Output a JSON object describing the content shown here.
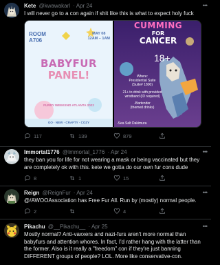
{
  "tweets": [
    {
      "name": "Kete",
      "handle": "@kwawakarl",
      "time": "Apr 24",
      "text": "I will never go to a con again if shit like this is what to expect holy fuck",
      "stats": {
        "reply": "117",
        "retweet": "139",
        "like": "879"
      },
      "media": {
        "left": {
          "room_line1": "ROOM",
          "room_line2": "A706",
          "date_line1": "MAY 08",
          "date_line2": "12AM – 1AM",
          "title_line1": "BABYFUR",
          "title_line2": "PANEL!",
          "footer": "FURRY WEEKEND ATLANTA 2022",
          "bottom": "GO · NEW · CRAFTY · COZY"
        },
        "right": {
          "headline1": "CUMMING",
          "headline2": "FOR",
          "headline3": "CANCER",
          "age": "18+",
          "where1": "Where:",
          "where2": "Presidential Suite",
          "where3": "(Suite# 1800)",
          "drink1": "21+ to drink with provided",
          "drink2": "wristband (ID required)",
          "bartender1": "-Bartender",
          "bartender2": "(themed drinks)",
          "host": "-Sea Salt Dakimura"
        }
      }
    },
    {
      "name": "Immortal1776",
      "handle": "@Immortal_1776",
      "time": "Apr 24",
      "text": "they ban you for life for not wearing a mask or being vaccinated but they are completely ok with this. kete we gotta do our own fur cons dude",
      "stats": {
        "reply": "8",
        "retweet": "1",
        "like": "15"
      }
    },
    {
      "name": "Reign",
      "handle": "@ReignFur",
      "time": "Apr 24",
      "text": "@/AWOOAssociation has Free Fur All. Run by (mostly) normal people.",
      "stats": {
        "reply": "2",
        "retweet": "",
        "like": "4"
      }
    },
    {
      "name": "Pikachu",
      "handle": "@__Pikachu__",
      "time": "Apr 25",
      "text": "Mostly normal? Anti-vaxxers and nazi-furs aren't more normal than babyfurs and attention whores. In fact, I'd rather hang with the latter than the former. Also is it really a \"freedom\" con if they're just banning DIFFERENT groups of people? LOL. More like conservative-con."
    }
  ],
  "colors": {
    "background": "#000000",
    "text": "#e7e9ea",
    "muted": "#71767b",
    "divider": "#2f3336"
  }
}
